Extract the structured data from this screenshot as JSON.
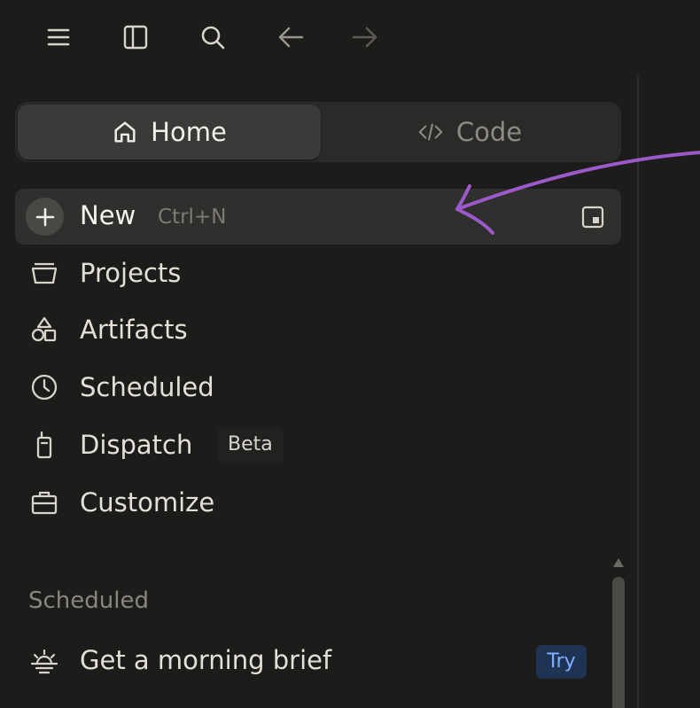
{
  "toolbar": {
    "icons": [
      "menu-icon",
      "sidebar-toggle-icon",
      "search-icon",
      "back-arrow-icon",
      "forward-arrow-icon"
    ]
  },
  "mode_switch": {
    "home_label": "Home",
    "code_label": "Code",
    "selected": "Home"
  },
  "new_item": {
    "label": "New",
    "shortcut": "Ctrl+N"
  },
  "nav": {
    "items": [
      {
        "label": "Projects",
        "icon": "projects-icon"
      },
      {
        "label": "Artifacts",
        "icon": "artifacts-icon"
      },
      {
        "label": "Scheduled",
        "icon": "clock-icon"
      },
      {
        "label": "Dispatch",
        "icon": "dispatch-icon",
        "badge": "Beta"
      },
      {
        "label": "Customize",
        "icon": "briefcase-icon"
      }
    ]
  },
  "scheduled_section": {
    "title": "Scheduled",
    "items": [
      {
        "label": "Get a morning brief",
        "icon": "sunrise-icon",
        "badge": "Try"
      }
    ]
  },
  "colors": {
    "background": "#1c1c1b",
    "annotation": "#9b59c9",
    "try_badge_bg": "#1f3354",
    "try_badge_text": "#7fb0ff"
  }
}
